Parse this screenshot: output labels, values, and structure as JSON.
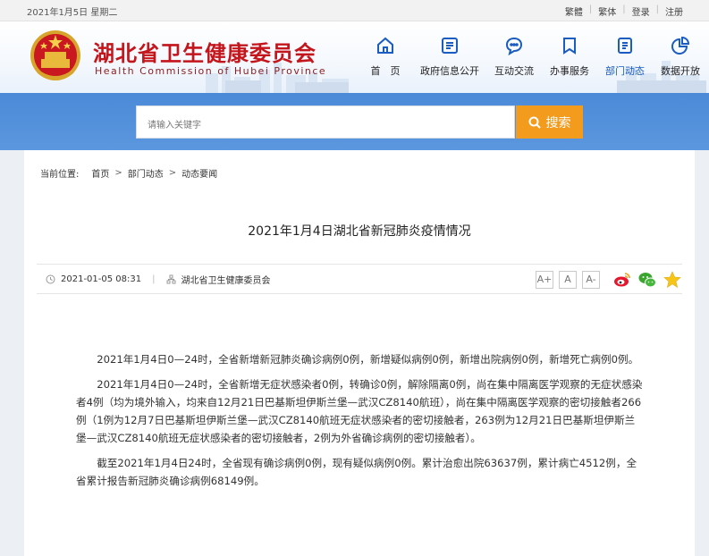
{
  "topbar": {
    "date": "2021年1月5日 星期二",
    "links": [
      "繁體",
      "繁体",
      "登录",
      "注册"
    ]
  },
  "header": {
    "title": "湖北省卫生健康委员会",
    "subtitle": "Health Commission of Hubei Province"
  },
  "nav": [
    {
      "label": "首　页",
      "icon": "home-icon"
    },
    {
      "label": "政府信息公开",
      "icon": "document-list-icon"
    },
    {
      "label": "互动交流",
      "icon": "chat-bubble-icon"
    },
    {
      "label": "办事服务",
      "icon": "bookmark-icon"
    },
    {
      "label": "部门动态",
      "icon": "news-icon"
    },
    {
      "label": "数据开放",
      "icon": "pie-chart-icon"
    }
  ],
  "search": {
    "placeholder": "请输入关键字",
    "button": "搜索"
  },
  "breadcrumb": {
    "label": "当前位置:",
    "items": [
      "首页",
      "部门动态",
      "动态要闻"
    ]
  },
  "article": {
    "title": "2021年1月4日湖北省新冠肺炎疫情情况",
    "datetime": "2021-01-05 08:31",
    "source": "湖北省卫生健康委员会",
    "font_sizes": [
      "A+",
      "A",
      "A-"
    ],
    "paragraphs": [
      "2021年1月4日0—24时，全省新增新冠肺炎确诊病例0例，新增疑似病例0例，新增出院病例0例，新增死亡病例0例。",
      "2021年1月4日0—24时，全省新增无症状感染者0例，转确诊0例，解除隔离0例，尚在集中隔离医学观察的无症状感染者4例（均为境外输入，均来自12月21日巴基斯坦伊斯兰堡—武汉CZ8140航班），尚在集中隔离医学观察的密切接触者266例（1例为12月7日巴基斯坦伊斯兰堡—武汉CZ8140航班无症状感染者的密切接触者，263例为12月21日巴基斯坦伊斯兰堡—武汉CZ8140航班无症状感染者的密切接触者，2例为外省确诊病例的密切接触者）。",
      "截至2021年1月4日24时，全省现有确诊病例0例，现有疑似病例0例。累计治愈出院63637例，累计病亡4512例，全省累计报告新冠肺炎确诊病例68149例。"
    ]
  },
  "colors": {
    "brand_red": "#c3151c",
    "nav_active": "#1a5cc0",
    "search_band": "#5592db",
    "search_button": "#f29b1d"
  }
}
